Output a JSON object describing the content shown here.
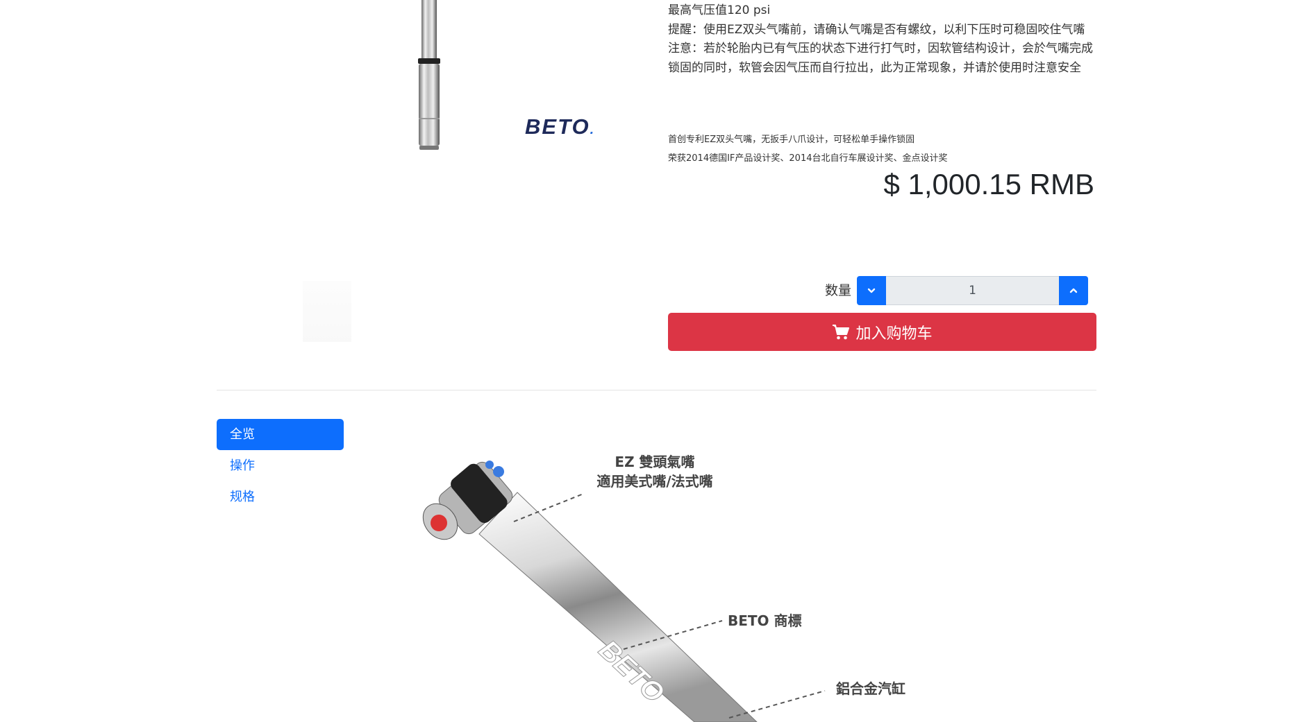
{
  "product": {
    "brand_logo": "BETO",
    "description": [
      "最高气压值120 psi",
      "提醒：使用EZ双头气嘴前，请确认气嘴是否有螺纹，以利下压时可稳固咬住气嘴",
      "注意：若於轮胎内已有气压的状态下进行打气时，因软管结构设计，会於气嘴完成锁固的同时，软管会因气压而自行拉出，此为正常现象，并请於使用时注意安全"
    ],
    "notes": [
      "首创专利EZ双头气嘴，无扳手八爪设计，可轻松单手操作锁固",
      "荣获2014德国IF产品设计奖、2014台北自行车展设计奖、金点设计奖"
    ],
    "price": "$ 1,000.15 RMB"
  },
  "quantity": {
    "label": "数量",
    "value": "1"
  },
  "cart": {
    "label": "加入购物车"
  },
  "tabs": [
    {
      "label": "全览",
      "active": true
    },
    {
      "label": "操作",
      "active": false
    },
    {
      "label": "规格",
      "active": false
    }
  ],
  "diagram": {
    "callouts": [
      {
        "line1": "EZ 雙頭氣嘴",
        "line2": "適用美式嘴/法式嘴"
      },
      {
        "line1": "BETO 商標"
      },
      {
        "line1": "鋁合金汽缸"
      }
    ],
    "tube_text": "BETO"
  },
  "colors": {
    "primary": "#0d6efd",
    "danger": "#dc3545"
  },
  "icons": [
    "chevron-down-icon",
    "chevron-up-icon",
    "shopping-cart-icon"
  ]
}
